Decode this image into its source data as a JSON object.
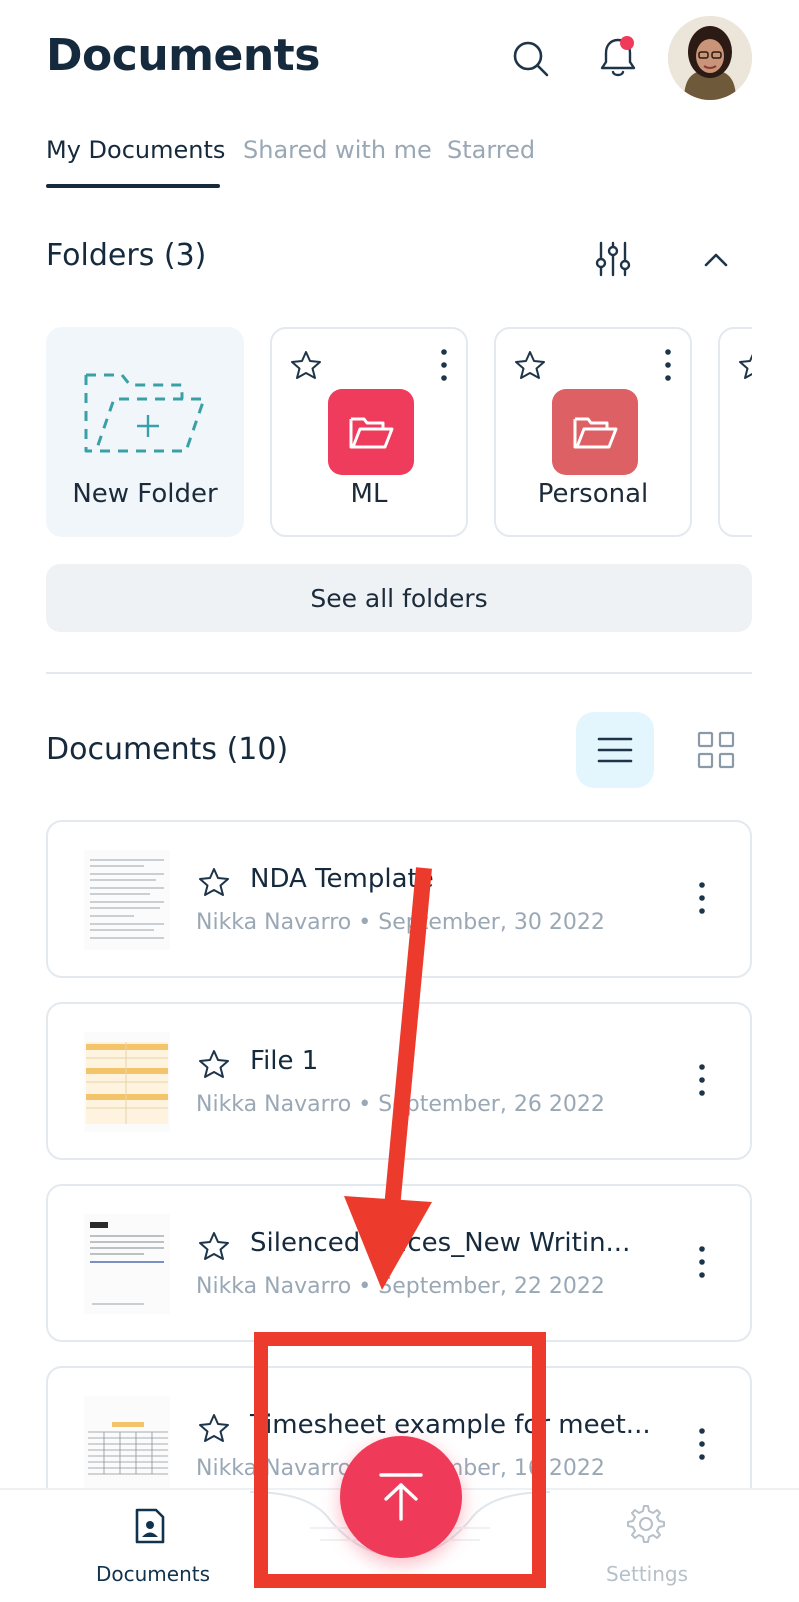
{
  "header": {
    "title": "Documents",
    "icons": [
      "search-icon",
      "bell-icon",
      "avatar"
    ],
    "notification_dot_color": "#f03a59"
  },
  "tabs": [
    {
      "label": "My Documents",
      "active": true
    },
    {
      "label": "Shared with me",
      "active": false
    },
    {
      "label": "Starred",
      "active": false
    }
  ],
  "folders": {
    "title": "Folders (3)",
    "new_folder_label": "New Folder",
    "items": [
      {
        "name": "ML",
        "color": "#ef3b5c"
      },
      {
        "name": "Personal",
        "color": "#dd6065"
      }
    ],
    "see_all_label": "See all folders"
  },
  "documents": {
    "title": "Documents (10)",
    "items": [
      {
        "name": "NDA Template",
        "owner": "Nikka Navarro",
        "separator": "•",
        "date": "September, 30 2022"
      },
      {
        "name": "File 1",
        "owner": "Nikka Navarro",
        "separator": "•",
        "date": "September, 26 2022"
      },
      {
        "name": "Silenced Voices_New Writin...",
        "owner": "Nikka Navarro",
        "separator": "•",
        "date": "September, 22 2022"
      },
      {
        "name": "Timesheet example for meet...",
        "owner": "Nikka Navarro",
        "separator": "•",
        "date": "September, 16 2022"
      }
    ]
  },
  "bottom_nav": {
    "documents_label": "Documents",
    "settings_label": "Settings",
    "active_color": "#12334d",
    "inactive_color": "#b6c0c9"
  },
  "fab": {
    "icon": "upload-icon",
    "color": "#f03a59"
  },
  "annotation": {
    "color": "#ec3b2d"
  }
}
